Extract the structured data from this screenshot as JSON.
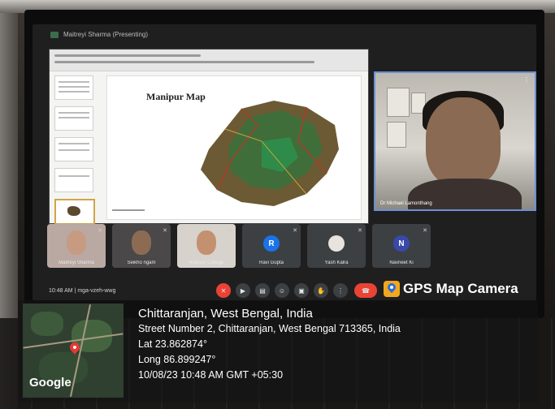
{
  "meeting": {
    "presenting_label": "Maitreyi Sharma (Presenting)",
    "time": "10:48 AM",
    "separator": "|",
    "code": "mga-vzeh-wwg"
  },
  "slide": {
    "title": "Manipur Map"
  },
  "presenter": {
    "name": "Dr Michael Lamonthang",
    "options_icon": "more-vertical-icon"
  },
  "participants": [
    {
      "name": "Maitreyi Sharma",
      "type": "video"
    },
    {
      "name": "Seikho ngam",
      "type": "video"
    },
    {
      "name": "Maitreyi College",
      "type": "video"
    },
    {
      "name": "Ravi Gupta",
      "type": "avatar",
      "initial": "R",
      "color": "#1a73e8"
    },
    {
      "name": "Yash Kalra",
      "type": "avatar-photo"
    },
    {
      "name": "Navneet Ki",
      "type": "avatar",
      "initial": "N",
      "color": "#3949ab"
    }
  ],
  "controls": [
    {
      "name": "mic-off-icon",
      "glyph": "✕"
    },
    {
      "name": "camera-icon",
      "glyph": "▶"
    },
    {
      "name": "captions-icon",
      "glyph": "▤"
    },
    {
      "name": "emoji-icon",
      "glyph": "☺"
    },
    {
      "name": "present-icon",
      "glyph": "▣"
    },
    {
      "name": "raise-hand-icon",
      "glyph": "✋"
    },
    {
      "name": "more-options-icon",
      "glyph": "⋮"
    },
    {
      "name": "end-call-icon",
      "glyph": "☎"
    }
  ],
  "gps": {
    "brand": "GPS Map Camera",
    "place": "Chittaranjan, West Bengal, India",
    "address": "Street Number 2, Chittaranjan, West Bengal 713365, India",
    "lat": "Lat 23.862874°",
    "long": "Long 86.899247°",
    "datetime": "10/08/23 10:48 AM GMT +05:30",
    "map_logo": "Google"
  },
  "colors": {
    "end_call": "#ea4335",
    "presenter_border": "#6b8fd6",
    "pin": "#e53935"
  }
}
